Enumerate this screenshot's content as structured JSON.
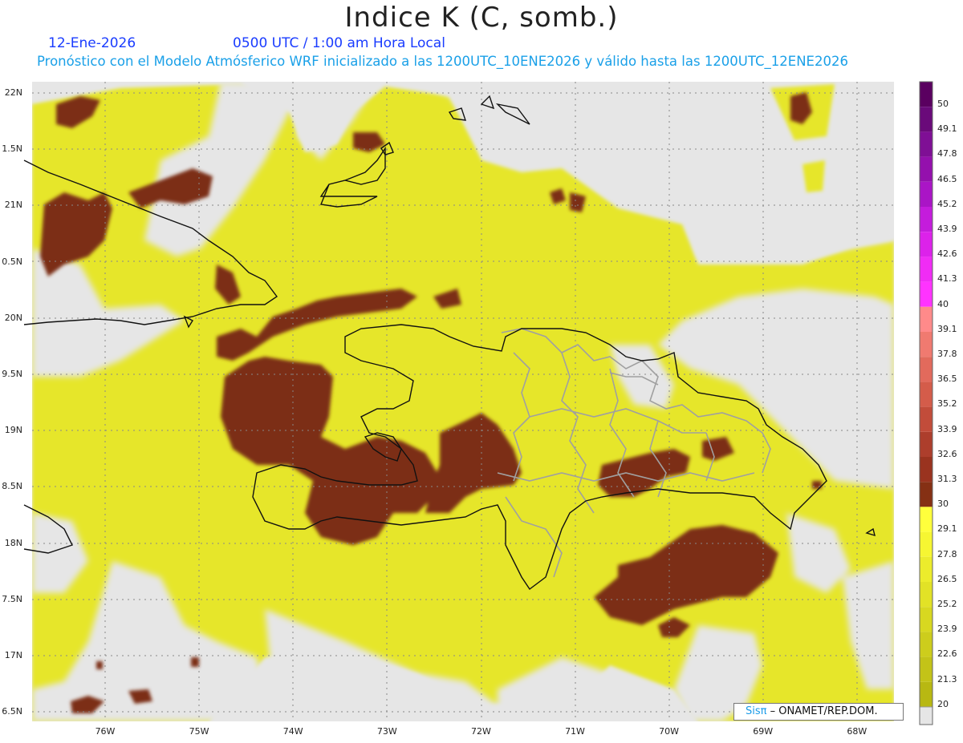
{
  "title": "Indice K (C, somb.)",
  "date": "12-Ene-2026",
  "time": "0500 UTC / 1:00 am Hora Local",
  "subtitle": "Pronóstico con el Modelo Atmósferico WRF inicializado a las 1200UTC_10ENE2026 y válido hasta las  1200UTC_12ENE2026",
  "lat_labels": [
    "22N",
    "1.5N",
    "21N",
    "0.5N",
    "20N",
    "9.5N",
    "19N",
    "8.5N",
    "18N",
    "7.5N",
    "17N",
    "6.5N"
  ],
  "lon_labels": [
    "76W",
    "75W",
    "74W",
    "73W",
    "72W",
    "71W",
    "70W",
    "69W",
    "68W"
  ],
  "colorbar": {
    "labels": [
      "50",
      "49.1",
      "47.8",
      "46.5",
      "45.2",
      "43.9",
      "42.6",
      "41.3",
      "40",
      "39.1",
      "37.8",
      "36.5",
      "35.2",
      "33.9",
      "32.6",
      "31.3",
      "30",
      "29.1",
      "27.8",
      "26.5",
      "25.2",
      "23.9",
      "22.6",
      "21.3",
      "20"
    ],
    "colors": [
      "#5a0060",
      "#6a0a7a",
      "#7f0f95",
      "#9410ad",
      "#aa15c6",
      "#c41cdc",
      "#dc22ea",
      "#f02cf5",
      "#ff33ff",
      "#ff8a8a",
      "#f07a70",
      "#e26a5c",
      "#d45c4a",
      "#c24c3a",
      "#ad3e2c",
      "#9a331f",
      "#853014",
      "#ffff3c",
      "#f6f632",
      "#ecec2c",
      "#e2e226",
      "#d8d820",
      "#cdcd1c",
      "#c3c318",
      "#b8b812"
    ],
    "below_color": "#e6e6e6"
  },
  "logo": {
    "brand": "Sisπ",
    "text": "– ONAMET/REP.DOM."
  }
}
